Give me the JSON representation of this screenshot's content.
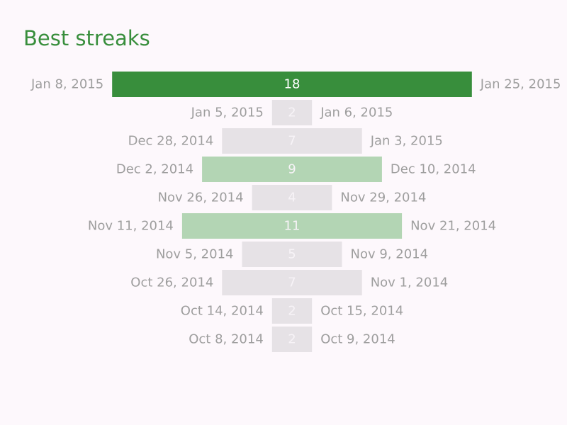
{
  "title": "Best streaks",
  "colors": {
    "title": "#388e3c",
    "date_text": "#9e9e9e",
    "bar_top": "#388e3c",
    "bar_mid": "#b3d5b4",
    "bar_low": "#e6e2e6",
    "value_on_dark": "#ffffff",
    "value_on_light": "#f7f3f7"
  },
  "chart_data": {
    "type": "bar",
    "orientation": "horizontal-centered",
    "title": "Best streaks",
    "streaks": [
      {
        "start": "Jan 8, 2015",
        "end": "Jan 25, 2015",
        "length": 18,
        "tier": "top"
      },
      {
        "start": "Jan 5, 2015",
        "end": "Jan 6, 2015",
        "length": 2,
        "tier": "low"
      },
      {
        "start": "Dec 28, 2014",
        "end": "Jan 3, 2015",
        "length": 7,
        "tier": "low"
      },
      {
        "start": "Dec 2, 2014",
        "end": "Dec 10, 2014",
        "length": 9,
        "tier": "mid"
      },
      {
        "start": "Nov 26, 2014",
        "end": "Nov 29, 2014",
        "length": 4,
        "tier": "low"
      },
      {
        "start": "Nov 11, 2014",
        "end": "Nov 21, 2014",
        "length": 11,
        "tier": "mid"
      },
      {
        "start": "Nov 5, 2014",
        "end": "Nov 9, 2014",
        "length": 5,
        "tier": "low"
      },
      {
        "start": "Oct 26, 2014",
        "end": "Nov 1, 2014",
        "length": 7,
        "tier": "low"
      },
      {
        "start": "Oct 14, 2014",
        "end": "Oct 15, 2014",
        "length": 2,
        "tier": "low"
      },
      {
        "start": "Oct 8, 2014",
        "end": "Oct 9, 2014",
        "length": 2,
        "tier": "low"
      }
    ]
  }
}
